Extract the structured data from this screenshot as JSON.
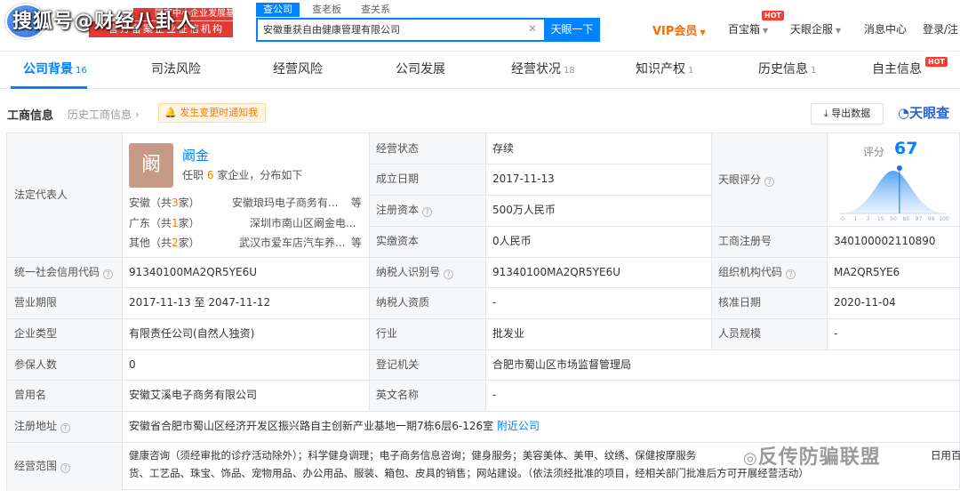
{
  "watermark": {
    "text": "搜狐号@财经八卦人",
    "bottom_text": "反传防骗联盟"
  },
  "header": {
    "promo_line1": "国家中小企业发展基金旗下",
    "promo_line2": "官方备案企业征信机构"
  },
  "search": {
    "tabs": [
      "查公司",
      "查老板",
      "查关系"
    ],
    "active_tab": 0,
    "value": "安徽重获自由健康管理有限公司",
    "button": "天眼一下"
  },
  "nav": {
    "vip": "VIP会员",
    "baibaoxiang": "百宝箱",
    "hot": "HOT",
    "tianyan_qipao": "天眼企服",
    "messages": "消息中心",
    "login": "登录/注"
  },
  "tabs": [
    {
      "label": "公司背景",
      "count": "16",
      "hot": ""
    },
    {
      "label": "司法风险",
      "count": "",
      "hot": ""
    },
    {
      "label": "经营风险",
      "count": "",
      "hot": ""
    },
    {
      "label": "公司发展",
      "count": "",
      "hot": ""
    },
    {
      "label": "经营状况",
      "count": "18",
      "hot": ""
    },
    {
      "label": "知识产权",
      "count": "1",
      "hot": ""
    },
    {
      "label": "历史信息",
      "count": "1",
      "hot": ""
    },
    {
      "label": "自主信息",
      "count": "",
      "hot": "HOT"
    }
  ],
  "section": {
    "title": "工商信息",
    "history": "历史工商信息",
    "notify": "发生变更时通知我",
    "export": "导出数据",
    "brand": "天眼查"
  },
  "legal_rep": {
    "label": "法定代表人",
    "avatar_char": "阚",
    "name": "阚金",
    "sub_prefix": "任职",
    "sub_count": "6",
    "sub_suffix": "家企业，分布如下",
    "distribution": [
      {
        "region": "安徽",
        "count": "3",
        "company": "安徽琅玛电子商务有...",
        "more": "等"
      },
      {
        "region": "广东",
        "count": "1",
        "company": "深圳市南山区阚金电...",
        "more": ""
      },
      {
        "region": "其他",
        "count": "2",
        "company": "武汉市爱车店汽车养...",
        "more": "等"
      }
    ]
  },
  "rows": {
    "status": {
      "label": "经营状态",
      "value": "存续"
    },
    "founded": {
      "label": "成立日期",
      "value": "2017-11-13"
    },
    "reg_capital": {
      "label": "注册资本",
      "value": "500万人民币"
    },
    "paid_capital": {
      "label": "实缴资本",
      "value": "0人民币"
    },
    "score": {
      "label": "天眼评分",
      "score_label": "评分",
      "score": "67"
    },
    "reg_no": {
      "label": "工商注册号",
      "value": "340100002110890"
    },
    "credit_code": {
      "label": "统一社会信用代码",
      "value": "91340100MA2QR5YE6U"
    },
    "taxpayer_id": {
      "label": "纳税人识别号",
      "value": "91340100MA2QR5YE6U"
    },
    "org_code": {
      "label": "组织机构代码",
      "value": "MA2QR5YE6"
    },
    "term": {
      "label": "营业期限",
      "value": "2017-11-13  至 2047-11-12"
    },
    "taxpayer_qual": {
      "label": "纳税人资质",
      "value": "-"
    },
    "approval": {
      "label": "核准日期",
      "value": "2020-11-04"
    },
    "type": {
      "label": "企业类型",
      "value": "有限责任公司(自然人独资)"
    },
    "industry": {
      "label": "行业",
      "value": "批发业"
    },
    "staff_size": {
      "label": "人员规模",
      "value": "-"
    },
    "insured": {
      "label": "参保人数",
      "value": "0"
    },
    "reg_authority": {
      "label": "登记机关",
      "value": "合肥市蜀山区市场监督管理局"
    },
    "former_name": {
      "label": "曾用名",
      "value": "安徽艾溪电子商务有限公司"
    },
    "english_name": {
      "label": "英文名称",
      "value": "-"
    },
    "address": {
      "label": "注册地址",
      "value": "安徽省合肥市蜀山区经济开发区振兴路自主创新产业基地一期7栋6层6-126室",
      "link": "附近公司"
    },
    "scope": {
      "label": "经营范围",
      "line1": "健康咨询（须经审批的诊疗活动除外）；科学健身调理；电子商务信息咨询；健身服务；美容美体、美甲、纹绣、保健按摩服务",
      "line1_tail": "日用百",
      "line2": "货、工艺品、珠宝、饰品、宠物用品、办公用品、服装、箱包、皮具的销售；网站建设。（依法须经批准的项目，经相关部门批准后方可开展经营活动）"
    }
  },
  "score_chart": {
    "type": "area",
    "x_ticks": [
      "0",
      "1",
      "3",
      "15",
      "50",
      "85",
      "97",
      "99",
      "100"
    ],
    "marker": 67
  }
}
